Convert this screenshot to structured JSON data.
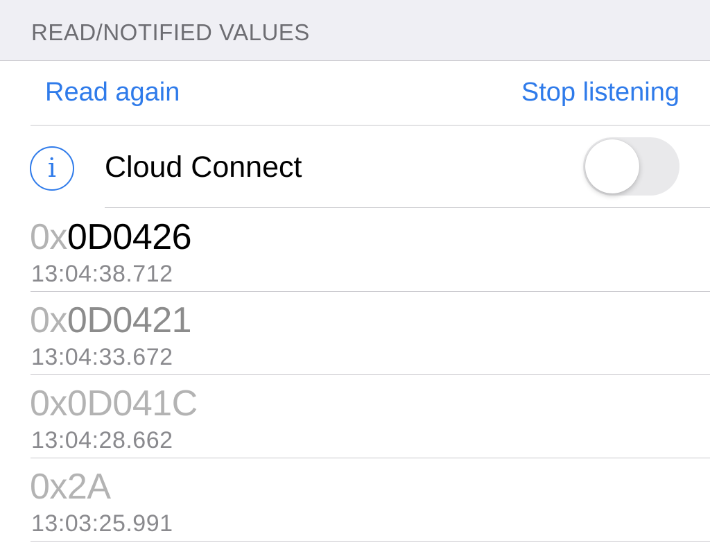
{
  "section": {
    "title": "READ/NOTIFIED VALUES"
  },
  "actions": {
    "read_again": "Read again",
    "stop_listening": "Stop listening"
  },
  "cloud_connect": {
    "icon": "info-icon",
    "icon_glyph": "i",
    "label": "Cloud Connect",
    "enabled": false
  },
  "values": [
    {
      "prefix": "0x",
      "hex": "0D0426",
      "time": "13:04:38.712"
    },
    {
      "prefix": "0x",
      "hex": "0D0421",
      "time": "13:04:33.672"
    },
    {
      "prefix": "0x",
      "hex": "0D041C",
      "time": "13:04:28.662"
    },
    {
      "prefix": "0x",
      "hex": "2A",
      "time": "13:03:25.991"
    }
  ],
  "colors": {
    "accent": "#2f7bea",
    "header_bg": "#efeff4",
    "separator": "#c8c7cc"
  }
}
